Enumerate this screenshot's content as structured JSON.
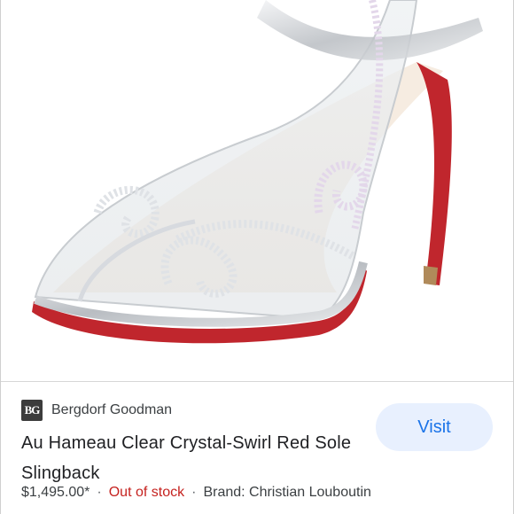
{
  "product_image": {
    "description_icon": "shoe-image",
    "sole_color": "#c0262d",
    "metal_color": "#c9ccd0"
  },
  "result": {
    "favicon_text": "BG",
    "source": "Bergdorf Goodman",
    "title": "Au Hameau Clear Crystal-Swirl Red Sole Slingback",
    "price": "$1,495.00*",
    "separator": "·",
    "stock_status": "Out of stock",
    "brand": "Brand: Christian Louboutin",
    "visit_label": "Visit"
  },
  "colors": {
    "accent": "#1a73e8",
    "button_bg": "#e8f0fe",
    "out_of_stock": "#c5221f"
  }
}
